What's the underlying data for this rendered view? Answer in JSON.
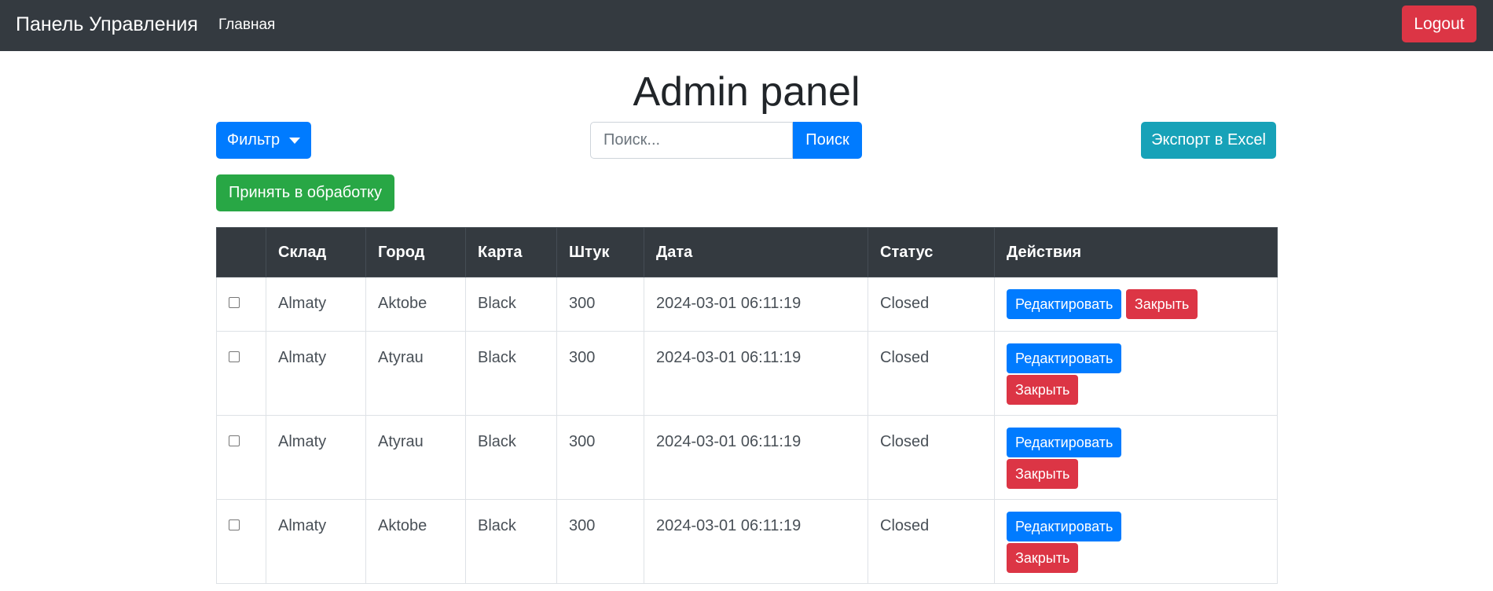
{
  "navbar": {
    "brand": "Панель Управления",
    "home_link": "Главная",
    "logout_label": "Logout"
  },
  "page": {
    "title": "Admin panel"
  },
  "toolbar": {
    "filter_label": "Фильтр",
    "search_placeholder": "Поиск...",
    "search_value": "",
    "search_button": "Поиск",
    "export_button": "Экспорт в Excel",
    "accept_button": "Принять в обработку"
  },
  "table": {
    "headers": [
      "",
      "Склад",
      "Город",
      "Карта",
      "Штук",
      "Дата",
      "Статус",
      "Действия"
    ],
    "rows": [
      {
        "warehouse": "Almaty",
        "city": "Aktobe",
        "card": "Black",
        "qty": "300",
        "date": "2024-03-01 06:11:19",
        "status": "Closed",
        "edit": "Редактировать",
        "close": "Закрыть"
      },
      {
        "warehouse": "Almaty",
        "city": "Atyrau",
        "card": "Black",
        "qty": "300",
        "date": "2024-03-01 06:11:19",
        "status": "Closed",
        "edit": "Редактировать",
        "close": "Закрыть"
      },
      {
        "warehouse": "Almaty",
        "city": "Atyrau",
        "card": "Black",
        "qty": "300",
        "date": "2024-03-01 06:11:19",
        "status": "Closed",
        "edit": "Редактировать",
        "close": "Закрыть"
      },
      {
        "warehouse": "Almaty",
        "city": "Aktobe",
        "card": "Black",
        "qty": "300",
        "date": "2024-03-01 06:11:19",
        "status": "Closed",
        "edit": "Редактировать",
        "close": "Закрыть"
      }
    ]
  },
  "colors": {
    "navbar_bg": "#343a40",
    "primary": "#007bff",
    "danger": "#dc3545",
    "success": "#28a745",
    "info": "#17a2b8"
  },
  "icons": {
    "filter_caret": "caret-down-icon",
    "row_checkbox": "checkbox"
  }
}
